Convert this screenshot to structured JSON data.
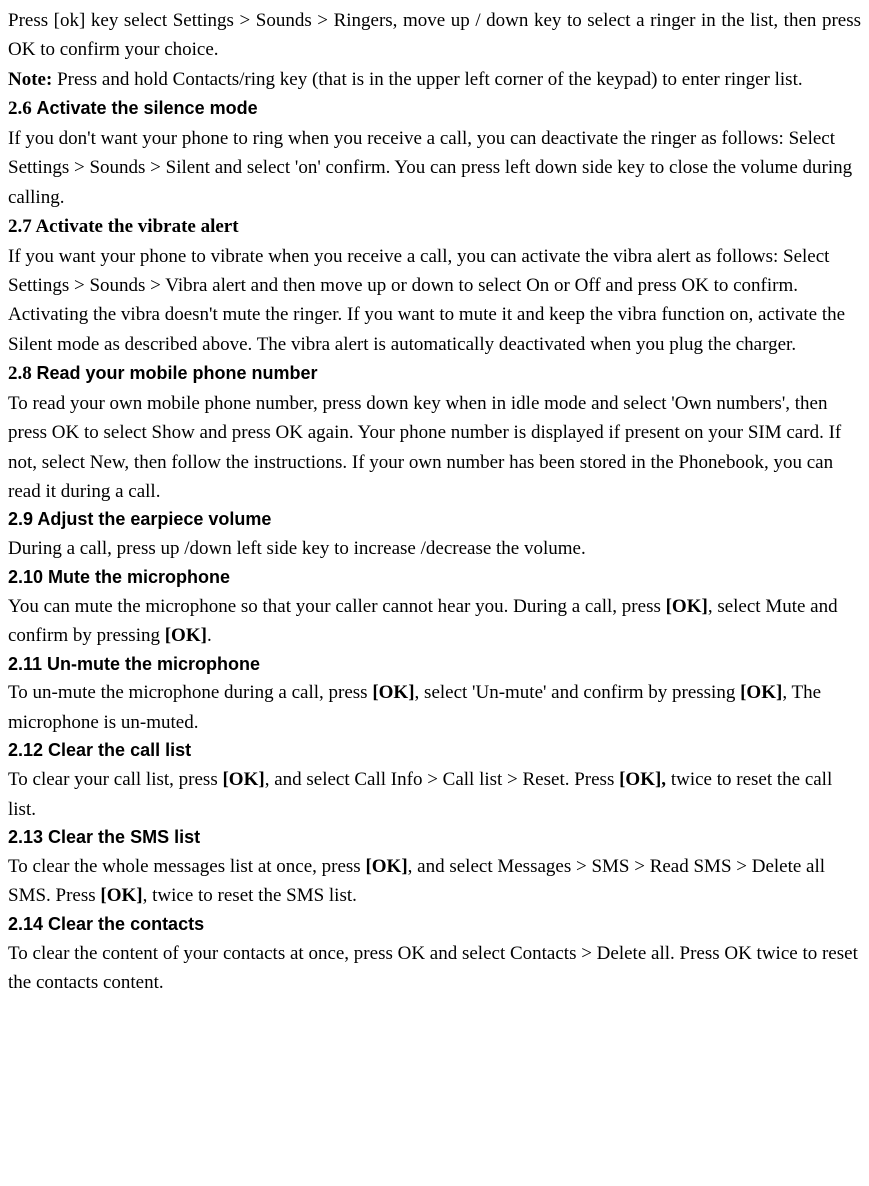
{
  "p1": "Press [ok] key select Settings > Sounds > Ringers, move up / down key to select a ringer in the list, then press OK to confirm your choice.",
  "p2a": "Note:",
  "p2b": " Press and hold Contacts/ring key (that is in the upper left corner of the keypad) to enter ringer list.",
  "h26_num": "2.6 ",
  "h26_title": "Activate the silence mode",
  "p3": "If you don't want your phone to ring when you receive a call, you can deactivate the ringer as follows: Select Settings > Sounds > Silent and select 'on' confirm. You can press left down side key to close the volume during calling.",
  "h27": "2.7 Activate the vibrate alert",
  "p4": "If you want your phone to vibrate when you receive a call, you can activate the vibra alert as follows: Select Settings > Sounds > Vibra alert and then move up or down to select On or Off and press OK to confirm.",
  "p5": "Activating the vibra doesn't mute the ringer. If you want to mute it and keep the vibra function on, activate the Silent mode as described above. The vibra alert is automatically deactivated when you plug the charger.",
  "h28_num": "2.8 ",
  "h28_title": "Read your mobile phone number",
  "p6": "To read your own mobile phone number, press down key when in idle mode and select 'Own numbers', then press OK to select Show and press OK again. Your phone number is displayed if present on your SIM card. If not, select New, then follow the instructions. If your own number has been stored in the Phonebook, you can read it during a call.",
  "h29": "2.9 Adjust the earpiece volume",
  "p7": "During a call, press up /down left side key to increase /decrease the volume.",
  "h210": "2.10 Mute the microphone",
  "p8a": "You can mute the microphone so that your caller cannot hear you. During a call, press ",
  "p8b": "[OK]",
  "p8c": ", select Mute and confirm by pressing ",
  "p8d": "[OK]",
  "p8e": ".",
  "h211": "2.11 Un-mute the microphone",
  "p9a": "To un-mute the microphone during a call, press ",
  "p9b": "[OK]",
  "p9c": ", select 'Un-mute' and confirm by pressing ",
  "p9d": "[OK]",
  "p9e": ", The microphone is un-muted.",
  "h212": "2.12 Clear the call list",
  "p10a": "To clear your call list, press ",
  "p10b": "[OK]",
  "p10c": ", and select Call Info > Call list > Reset. Press ",
  "p10d": "[OK],",
  "p10e": " twice to reset the call list.",
  "h213": "2.13 Clear the SMS list",
  "p11a": "To clear the whole messages list at once, press ",
  "p11b": "[OK]",
  "p11c": ", and select Messages > SMS > Read SMS > Delete all SMS. Press ",
  "p11d": "[OK]",
  "p11e": ", twice to reset the SMS list.",
  "h214": "2.14 Clear the contacts",
  "p12": "To clear the content of your contacts at once, press OK and select Contacts > Delete all. Press OK twice to reset the contacts content."
}
